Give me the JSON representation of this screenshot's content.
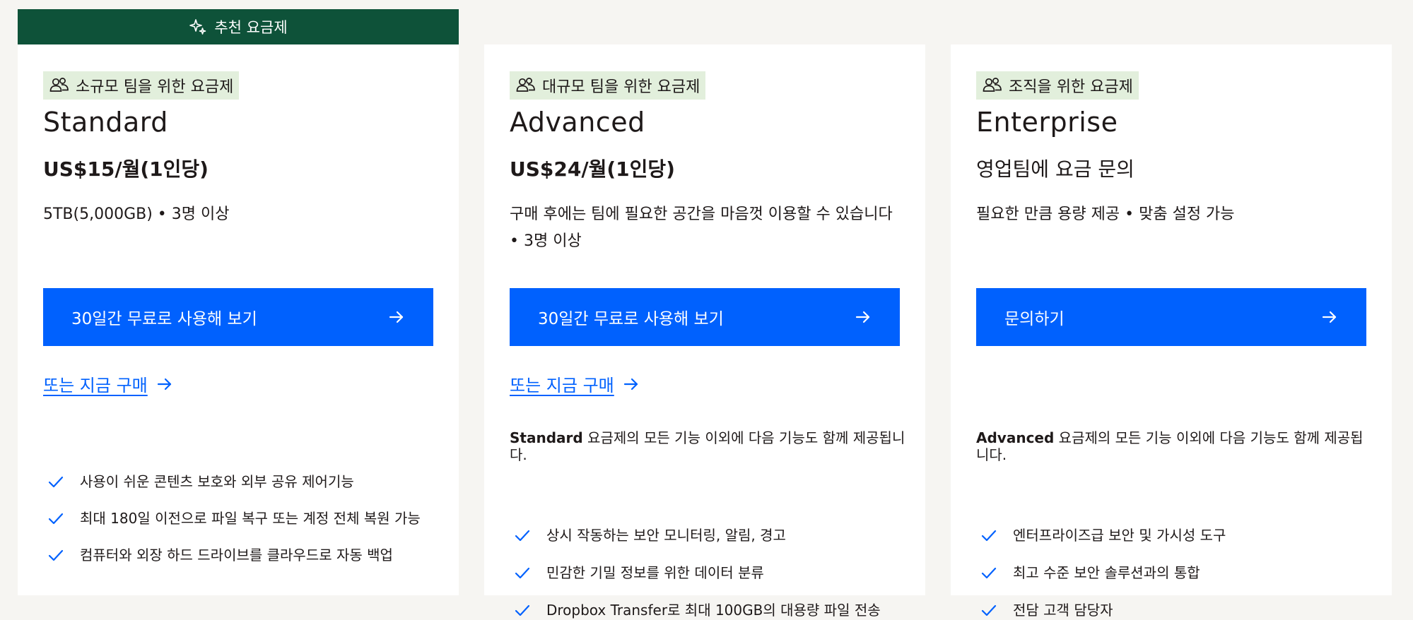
{
  "banner": {
    "icon": "sparkle-icon",
    "label": "추천 요금제"
  },
  "colors": {
    "page_background": "#f6f5f2",
    "banner_green": "#0e5239",
    "tag_green": "#e2efdc",
    "cta_blue": "#0061fe",
    "text": "#1e1919"
  },
  "plans": [
    {
      "tag_icon": "people-icon",
      "tag": "소규모 팀을 위한 요금제",
      "name": "Standard",
      "price": "US$15/월(1인당)",
      "description": "5TB(5,000GB) • 3명 이상",
      "cta": "30일간 무료로 사용해 보기",
      "buy_link": "또는 지금 구매",
      "features_intro_bold": "",
      "features_intro_rest": "",
      "features": [
        "사용이 쉬운 콘텐츠 보호와 외부 공유 제어기능",
        "최대 180일 이전으로 파일 복구 또는 계정 전체 복원 가능",
        "컴퓨터와 외장 하드 드라이브를 클라우드로 자동 백업"
      ]
    },
    {
      "tag_icon": "people-icon",
      "tag": "대규모 팀을 위한 요금제",
      "name": "Advanced",
      "price": "US$24/월(1인당)",
      "description": "구매 후에는 팀에 필요한 공간을 마음껏 이용할 수 있습니다 • 3명 이상",
      "cta": "30일간 무료로 사용해 보기",
      "buy_link": "또는 지금 구매",
      "features_intro_bold": "Standard",
      "features_intro_rest": " 요금제의 모든 기능 이외에 다음 기능도 함께 제공됩니다.",
      "features": [
        "상시 작동하는 보안 모니터링, 알림, 경고",
        "민감한 기밀 정보를 위한 데이터 분류",
        "Dropbox Transfer로 최대 100GB의 대용량 파일 전송"
      ]
    },
    {
      "tag_icon": "people-icon",
      "tag": "조직을 위한 요금제",
      "name": "Enterprise",
      "price": "영업팀에 요금 문의",
      "description": "필요한 만큼 용량 제공 • 맞춤 설정 가능",
      "cta": "문의하기",
      "buy_link": "",
      "features_intro_bold": "Advanced",
      "features_intro_rest": " 요금제의 모든 기능 이외에 다음 기능도 함께 제공됩니다.",
      "features": [
        "엔터프라이즈급 보안 및 가시성 도구",
        "최고 수준 보안 솔루션과의 통합",
        "전담 고객 담당자"
      ]
    }
  ]
}
